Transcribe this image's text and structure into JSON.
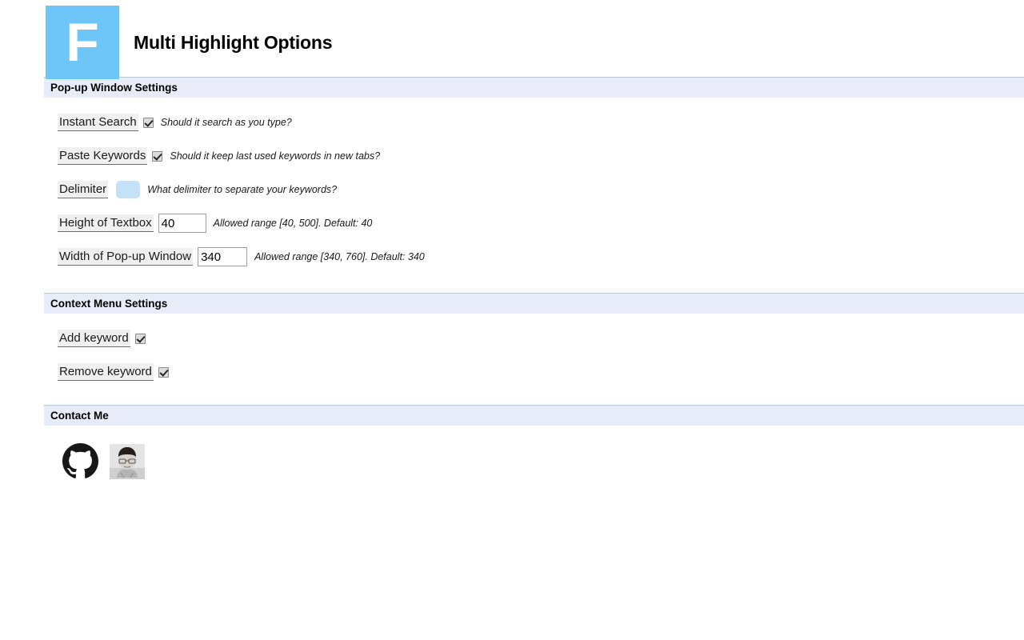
{
  "header": {
    "logo_letter": "F",
    "logo_color": "#6ec5f7",
    "title": "Multi Highlight Options"
  },
  "sections": [
    {
      "id": "popup-window-settings",
      "title": "Pop-up Window Settings",
      "options": [
        {
          "id": "instant-search",
          "label": "Instant Search",
          "control": "checkbox",
          "checked": true,
          "help": "Should it search as you type?"
        },
        {
          "id": "paste-keywords",
          "label": "Paste Keywords",
          "control": "checkbox",
          "checked": true,
          "help": "Should it keep last used keywords in new tabs?"
        },
        {
          "id": "delimiter",
          "label": "Delimiter",
          "control": "text",
          "value": "",
          "help": "What delimiter to separate your keywords?"
        },
        {
          "id": "height-of-textbox",
          "label": "Height of Textbox",
          "control": "text",
          "value": "40",
          "help": "Allowed range [40, 500]. Default: 40"
        },
        {
          "id": "width-of-popup-window",
          "label": "Width of Pop-up Window",
          "control": "text",
          "value": "340",
          "help": "Allowed range [340, 760]. Default: 340"
        }
      ]
    },
    {
      "id": "context-menu-settings",
      "title": "Context Menu Settings",
      "options": [
        {
          "id": "add-keyword",
          "label": "Add keyword",
          "control": "checkbox",
          "checked": true,
          "help": ""
        },
        {
          "id": "remove-keyword",
          "label": "Remove keyword",
          "control": "checkbox",
          "checked": true,
          "help": ""
        }
      ]
    },
    {
      "id": "contact-me",
      "title": "Contact Me",
      "links": [
        {
          "id": "github",
          "icon": "github-icon"
        },
        {
          "id": "author-avatar",
          "icon": "avatar-photo-icon"
        }
      ]
    }
  ]
}
